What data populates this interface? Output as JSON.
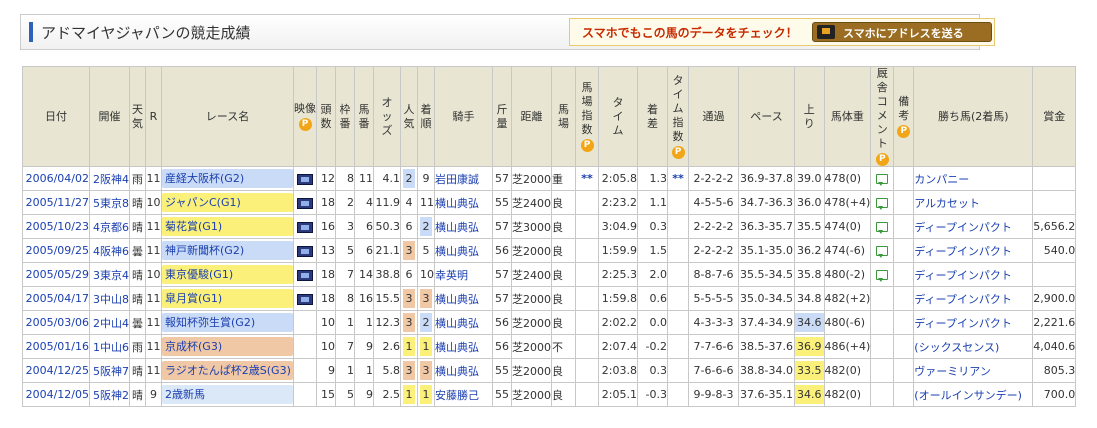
{
  "title": "アドマイヤジャパンの競走成績",
  "promo": {
    "text": "スマホでもこの馬のデータをチェック！",
    "button": "スマホにアドレスを送る"
  },
  "headers": [
    "日付",
    "開催",
    "天気",
    "R",
    "レース名",
    "映像",
    "頭数",
    "枠番",
    "馬番",
    "オッズ",
    "人気",
    "着順",
    "騎手",
    "斤量",
    "距離",
    "馬場",
    "馬場指数",
    "タイム",
    "着差",
    "タイム指数",
    "通過",
    "ペース",
    "上り",
    "馬体重",
    "厩舎コメント",
    "備考",
    "勝ち馬(2着馬)",
    "賞金"
  ],
  "premium_badge": "P",
  "rows": [
    {
      "date": "2006/04/02",
      "kaisai": "2阪神4",
      "weather": "雨",
      "r": "11",
      "race": "産経大阪杯(G2)",
      "grade": "g2",
      "tosu": "12",
      "waku": "8",
      "uma": "11",
      "odds": "4.1",
      "ninki": "2",
      "chaku": "9",
      "jockey": "岩田康誠",
      "kinryo": "57",
      "dist": "芝2000",
      "baba": "重",
      "babaidx": "**",
      "time": "2:05.8",
      "chakusa": "1.3",
      "timeidx": "**",
      "tsuka": "2-2-2-2",
      "pace": "36.9-37.8",
      "agari": "39.0",
      "weight": "478(0)",
      "winner": "カンパニー",
      "prize": "",
      "video": true,
      "comment": true
    },
    {
      "date": "2005/11/27",
      "kaisai": "5東京8",
      "weather": "晴",
      "r": "10",
      "race": "ジャパンC(G1)",
      "grade": "g1",
      "tosu": "18",
      "waku": "2",
      "uma": "4",
      "odds": "11.9",
      "ninki": "4",
      "chaku": "11",
      "jockey": "横山典弘",
      "kinryo": "55",
      "dist": "芝2400",
      "baba": "良",
      "babaidx": "",
      "time": "2:23.2",
      "chakusa": "1.1",
      "timeidx": "",
      "tsuka": "4-5-5-6",
      "pace": "34.7-36.3",
      "agari": "36.0",
      "weight": "478(+4)",
      "winner": "アルカセット",
      "prize": "",
      "video": true,
      "comment": true
    },
    {
      "date": "2005/10/23",
      "kaisai": "4京都6",
      "weather": "晴",
      "r": "11",
      "race": "菊花賞(G1)",
      "grade": "g1",
      "tosu": "16",
      "waku": "3",
      "uma": "6",
      "odds": "50.3",
      "ninki": "6",
      "chaku": "2",
      "jockey": "横山典弘",
      "kinryo": "57",
      "dist": "芝3000",
      "baba": "良",
      "babaidx": "",
      "time": "3:04.9",
      "chakusa": "0.3",
      "timeidx": "",
      "tsuka": "2-2-2-2",
      "pace": "36.3-35.7",
      "agari": "35.5",
      "weight": "474(0)",
      "winner": "ディープインパクト",
      "prize": "5,656.2",
      "video": true,
      "comment": true
    },
    {
      "date": "2005/09/25",
      "kaisai": "4阪神6",
      "weather": "曇",
      "r": "11",
      "race": "神戸新聞杯(G2)",
      "grade": "g2",
      "tosu": "13",
      "waku": "5",
      "uma": "6",
      "odds": "21.1",
      "ninki": "3",
      "chaku": "5",
      "jockey": "横山典弘",
      "kinryo": "56",
      "dist": "芝2000",
      "baba": "良",
      "babaidx": "",
      "time": "1:59.9",
      "chakusa": "1.5",
      "timeidx": "",
      "tsuka": "2-2-2-2",
      "pace": "35.1-35.0",
      "agari": "36.2",
      "weight": "474(-6)",
      "winner": "ディープインパクト",
      "prize": "540.0",
      "video": true,
      "comment": true
    },
    {
      "date": "2005/05/29",
      "kaisai": "3東京4",
      "weather": "晴",
      "r": "10",
      "race": "東京優駿(G1)",
      "grade": "g1",
      "tosu": "18",
      "waku": "7",
      "uma": "14",
      "odds": "38.8",
      "ninki": "6",
      "chaku": "10",
      "jockey": "幸英明",
      "kinryo": "57",
      "dist": "芝2400",
      "baba": "良",
      "babaidx": "",
      "time": "2:25.3",
      "chakusa": "2.0",
      "timeidx": "",
      "tsuka": "8-8-7-6",
      "pace": "35.5-34.5",
      "agari": "35.8",
      "weight": "480(-2)",
      "winner": "ディープインパクト",
      "prize": "",
      "video": true,
      "comment": true
    },
    {
      "date": "2005/04/17",
      "kaisai": "3中山8",
      "weather": "晴",
      "r": "11",
      "race": "皐月賞(G1)",
      "grade": "g1",
      "tosu": "18",
      "waku": "8",
      "uma": "16",
      "odds": "15.5",
      "ninki": "3",
      "chaku": "3",
      "jockey": "横山典弘",
      "kinryo": "57",
      "dist": "芝2000",
      "baba": "良",
      "babaidx": "",
      "time": "1:59.8",
      "chakusa": "0.6",
      "timeidx": "",
      "tsuka": "5-5-5-5",
      "pace": "35.0-34.5",
      "agari": "34.8",
      "weight": "482(+2)",
      "winner": "ディープインパクト",
      "prize": "2,900.0",
      "video": true,
      "comment": false
    },
    {
      "date": "2005/03/06",
      "kaisai": "2中山4",
      "weather": "曇",
      "r": "11",
      "race": "報知杯弥生賞(G2)",
      "grade": "g2",
      "tosu": "10",
      "waku": "1",
      "uma": "1",
      "odds": "12.3",
      "ninki": "3",
      "chaku": "2",
      "jockey": "横山典弘",
      "kinryo": "56",
      "dist": "芝2000",
      "baba": "良",
      "babaidx": "",
      "time": "2:02.2",
      "chakusa": "0.0",
      "timeidx": "",
      "tsuka": "4-3-3-3",
      "pace": "37.4-34.9",
      "agari": "34.6",
      "weight": "480(-6)",
      "winner": "ディープインパクト",
      "prize": "2,221.6",
      "video": false,
      "comment": false
    },
    {
      "date": "2005/01/16",
      "kaisai": "1中山6",
      "weather": "雨",
      "r": "11",
      "race": "京成杯(G3)",
      "grade": "g3",
      "tosu": "10",
      "waku": "7",
      "uma": "9",
      "odds": "2.6",
      "ninki": "1",
      "chaku": "1",
      "jockey": "横山典弘",
      "kinryo": "56",
      "dist": "芝2000",
      "baba": "不",
      "babaidx": "",
      "time": "2:07.4",
      "chakusa": "-0.2",
      "timeidx": "",
      "tsuka": "7-7-6-6",
      "pace": "38.5-37.6",
      "agari": "36.9",
      "weight": "486(+4)",
      "winner": "(シックスセンス)",
      "prize": "4,040.6",
      "video": false,
      "comment": false
    },
    {
      "date": "2004/12/25",
      "kaisai": "5阪神7",
      "weather": "晴",
      "r": "11",
      "race": "ラジオたんぱ杯2歳S(G3)",
      "grade": "g3",
      "tosu": "9",
      "waku": "1",
      "uma": "1",
      "odds": "5.8",
      "ninki": "3",
      "chaku": "3",
      "jockey": "横山典弘",
      "kinryo": "55",
      "dist": "芝2000",
      "baba": "良",
      "babaidx": "",
      "time": "2:03.8",
      "chakusa": "0.3",
      "timeidx": "",
      "tsuka": "7-6-6-6",
      "pace": "38.8-34.0",
      "agari": "33.5",
      "weight": "482(0)",
      "winner": "ヴァーミリアン",
      "prize": "805.3",
      "video": false,
      "comment": false
    },
    {
      "date": "2004/12/05",
      "kaisai": "5阪神2",
      "weather": "晴",
      "r": "9",
      "race": "2歳新馬",
      "grade": "gx",
      "tosu": "15",
      "waku": "5",
      "uma": "9",
      "odds": "2.5",
      "ninki": "1",
      "chaku": "1",
      "jockey": "安藤勝己",
      "kinryo": "55",
      "dist": "芝2000",
      "baba": "良",
      "babaidx": "",
      "time": "2:05.1",
      "chakusa": "-0.3",
      "timeidx": "",
      "tsuka": "9-9-8-3",
      "pace": "37.6-35.1",
      "agari": "34.6",
      "weight": "482(0)",
      "winner": "(オールインサンデー)",
      "prize": "700.0",
      "video": false,
      "comment": false
    }
  ]
}
